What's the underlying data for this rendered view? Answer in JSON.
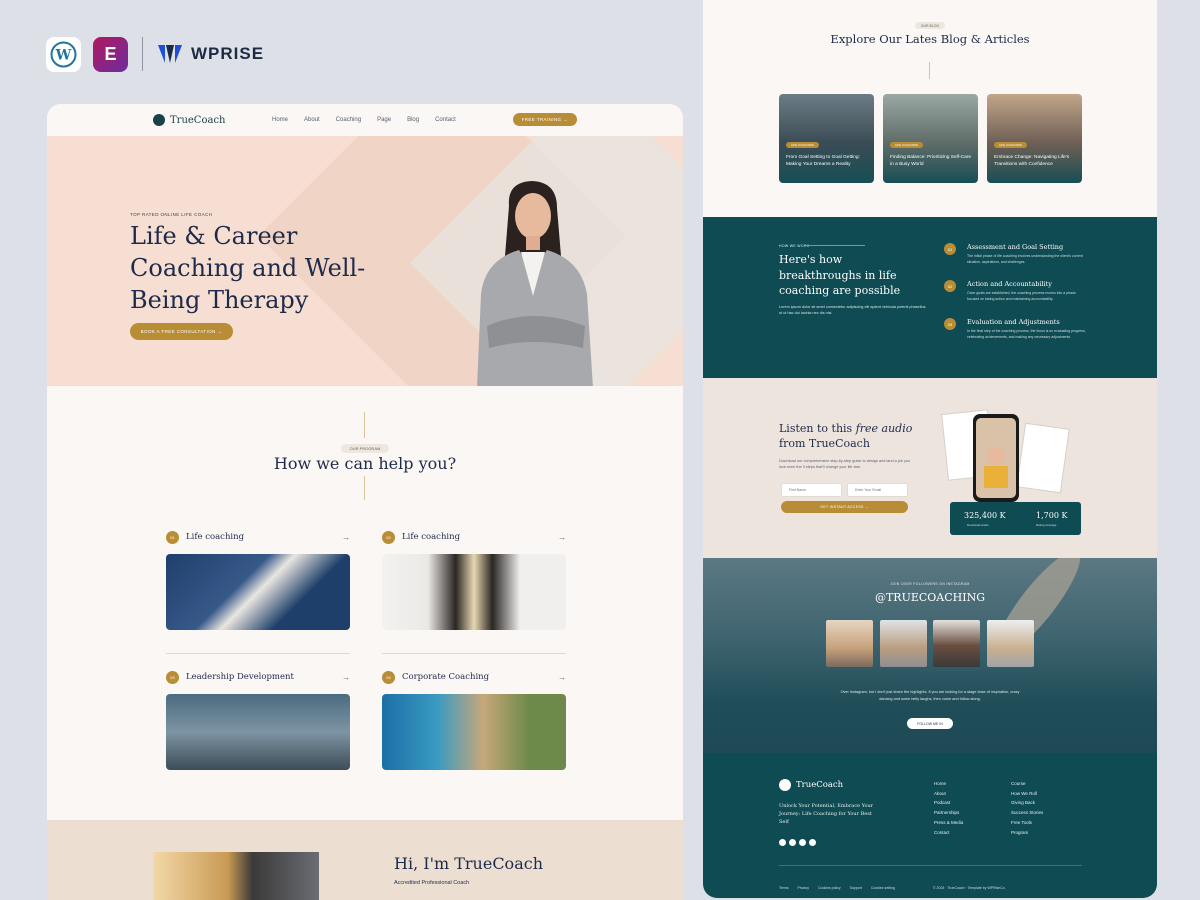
{
  "brands": {
    "wordpress_letter": "W",
    "elementor_letter": "E",
    "wprise": "WPRISE"
  },
  "nav": {
    "logo": "TrueCoach",
    "items": [
      "Home",
      "About",
      "Coaching",
      "Page",
      "Blog",
      "Contact"
    ],
    "cta": "FREE TRAINING →"
  },
  "hero": {
    "kicker": "TOP RATED ONLINE LIFE COACH",
    "title": "Life & Career Coaching and Well-Being Therapy",
    "cta": "BOOK A FREE CONSULTATION →"
  },
  "help": {
    "badge": "OUR PROGRAM",
    "title": "How we can help you?"
  },
  "services": [
    {
      "num": "01",
      "label": "Life coaching"
    },
    {
      "num": "02",
      "label": "Life coaching"
    },
    {
      "num": "03",
      "label": "Leadership Development"
    },
    {
      "num": "04",
      "label": "Corporate Coaching"
    }
  ],
  "about": {
    "title": "Hi, I'm TrueCoach",
    "subtitle": "Accredited Professional Coach"
  },
  "blog": {
    "badge": "OUR BLOG",
    "title": "Explore Our Lates Blog & Articles",
    "posts": [
      {
        "tag": "LIFE COACHING",
        "title": "From Goal Setting to Goal Getting: Making Your Dreams a Reality"
      },
      {
        "tag": "LIFE COACHING",
        "title": "Finding Balance: Prioritizing Self-Care in a Busy World"
      },
      {
        "tag": "LIFE COACHING",
        "title": "Embrace Change: Navigating Life's Transitions with Confidence"
      }
    ]
  },
  "breakthroughs": {
    "kicker": "HOW WE WORK",
    "title": "Here's how breakthroughs in life coaching are possible",
    "desc": "Lorem ipsum dolor sit amet consectetur adipiscing elit aptent vehicula potenti phasellus ut ut hac dui lacinia nec dis nisi.",
    "steps": [
      {
        "num": "01",
        "title": "Assessment and Goal Setting",
        "desc": "The initial phase of life coaching involves understanding the client's current situation, aspirations, and challenges."
      },
      {
        "num": "02",
        "title": "Action and Accountability",
        "desc": "Once goals are established, the coaching process moves into a phase focused on taking action and maintaining accountability."
      },
      {
        "num": "03",
        "title": "Evaluation and Adjustments",
        "desc": "In the final step of the coaching process, the focus is on evaluating progress, celebrating achievements, and making any necessary adjustments."
      }
    ]
  },
  "audio": {
    "title_start": "Listen to this ",
    "title_em": "free audio",
    "title_end": " from TrueCoach",
    "desc": "Download our comprehensive step-by-step guide to design and land a job you love even the 3 steps that'll change your life fast.",
    "name_placeholder": "First Name",
    "email_placeholder": "Enter Your Email",
    "cta": "GET INSTANT ACCESS →",
    "stats": [
      {
        "value": "325,400 K",
        "label": "Download Audio"
      },
      {
        "value": "1,700 K",
        "label": "Rating Average"
      }
    ]
  },
  "instagram": {
    "kicker": "JOIN OVER FOLLOWERS ON INSTAGRAM",
    "handle": "@TRUECOACHING",
    "desc": "Over Instagram, but I don't just share the highlights. If you are looking for a stage dose of inspiration, crazy dancing and some belly laughs, then come and follow along.",
    "cta": "FOLLOW ME IN"
  },
  "footer": {
    "logo": "TrueCoach",
    "tagline": "Unlock Your Potential, Embrace Your Journey: Life Coaching for Your Best Self",
    "col1": [
      "Home",
      "About",
      "Podcast",
      "Partnerships",
      "Press & Media",
      "Contact"
    ],
    "col2": [
      "Course",
      "How We Roll",
      "Giving Back",
      "Success Stories",
      "Free Tools",
      "Program"
    ],
    "bottom_links": [
      "Terms",
      "Privacy",
      "Cookies policy",
      "Support",
      "Cookies setting"
    ],
    "copyright": "© 2024 · TrueCoach · Template by WPRiseCo."
  },
  "colors": {
    "gold": "#b88d36",
    "teal": "#0f4b52",
    "peach": "#f6ded2",
    "navy": "#1e2a4a"
  }
}
